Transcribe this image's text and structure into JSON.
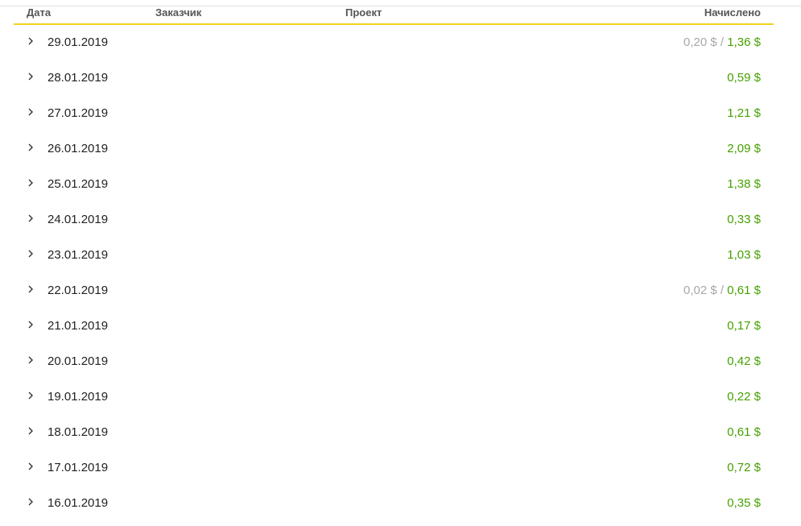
{
  "table": {
    "columns": {
      "date": "Дата",
      "customer": "Заказчик",
      "project": "Проект",
      "accrued": "Начислено"
    },
    "rows": [
      {
        "date": "29.01.2019",
        "pending": "0,20 $",
        "total": "1,36 $"
      },
      {
        "date": "28.01.2019",
        "pending": "",
        "total": "0,59 $"
      },
      {
        "date": "27.01.2019",
        "pending": "",
        "total": "1,21 $"
      },
      {
        "date": "26.01.2019",
        "pending": "",
        "total": "2,09 $"
      },
      {
        "date": "25.01.2019",
        "pending": "",
        "total": "1,38 $"
      },
      {
        "date": "24.01.2019",
        "pending": "",
        "total": "0,33 $"
      },
      {
        "date": "23.01.2019",
        "pending": "",
        "total": "1,03 $"
      },
      {
        "date": "22.01.2019",
        "pending": "0,02 $",
        "total": "0,61 $"
      },
      {
        "date": "21.01.2019",
        "pending": "",
        "total": "0,17 $"
      },
      {
        "date": "20.01.2019",
        "pending": "",
        "total": "0,42 $"
      },
      {
        "date": "19.01.2019",
        "pending": "",
        "total": "0,22 $"
      },
      {
        "date": "18.01.2019",
        "pending": "",
        "total": "0,61 $"
      },
      {
        "date": "17.01.2019",
        "pending": "",
        "total": "0,72 $"
      },
      {
        "date": "16.01.2019",
        "pending": "",
        "total": "0,35 $"
      }
    ]
  },
  "colors": {
    "accent_underline": "#f2d21b",
    "amount_green": "#45a100",
    "amount_pending_gray": "#a8a8a8"
  },
  "icons": {
    "row_expand": "chevron-right-icon"
  }
}
